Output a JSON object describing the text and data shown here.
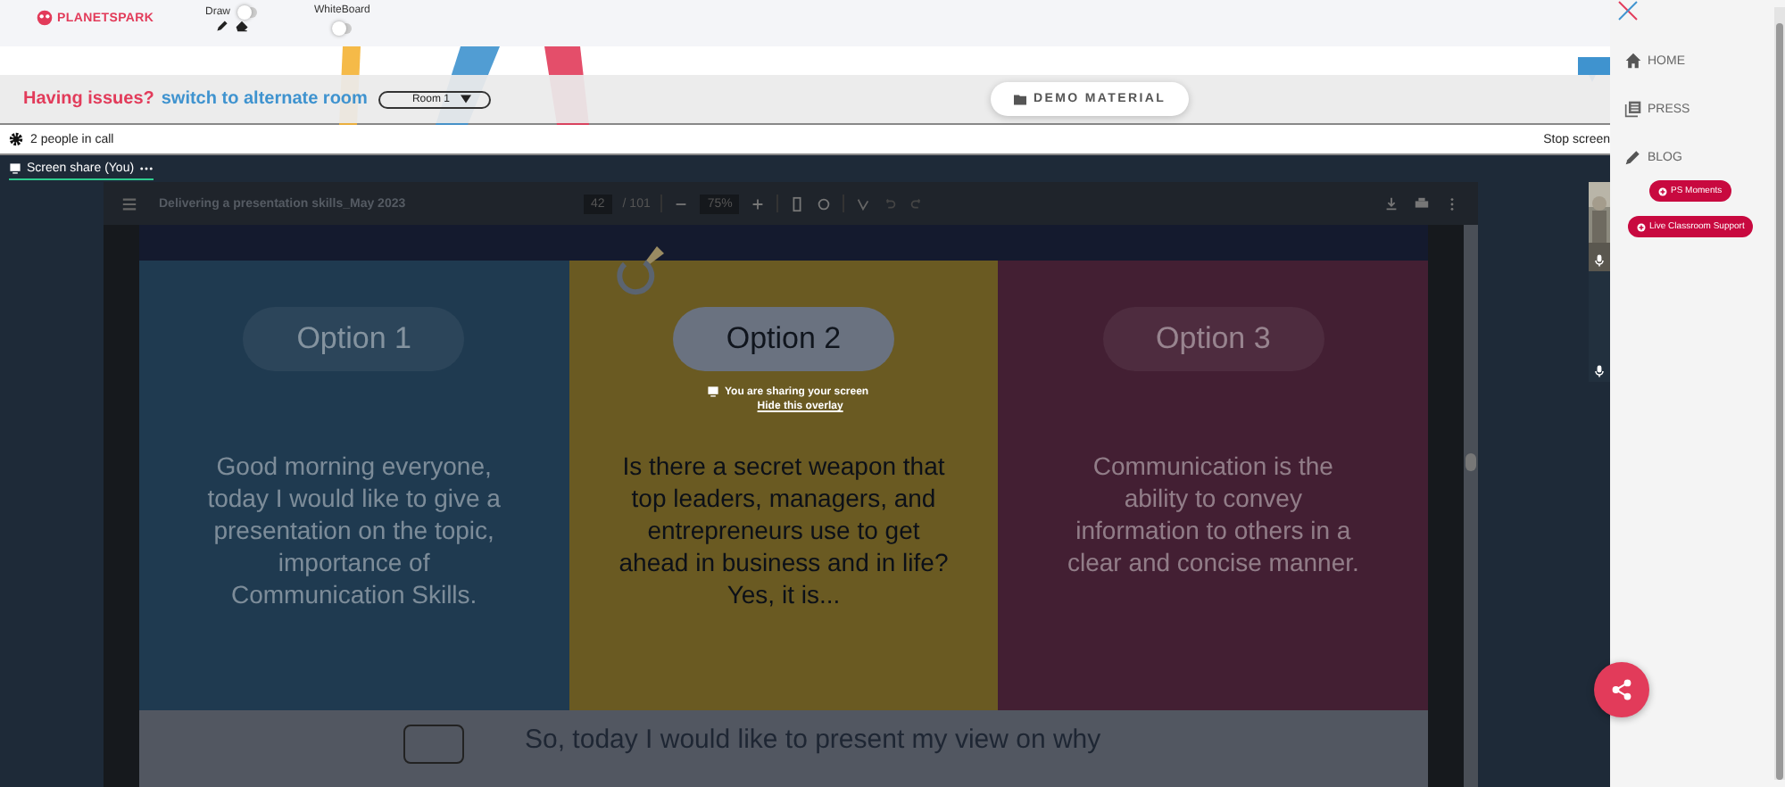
{
  "header": {
    "logo": "PLANETSPARK",
    "draw": {
      "label": "Draw",
      "on": false
    },
    "whiteboard": {
      "label": "WhiteBoard",
      "on": false
    }
  },
  "issues": {
    "question": "Having issues?",
    "link": "switch to alternate room",
    "room": "Room 1"
  },
  "demo_button": "DEMO MATERIAL",
  "call_bar": {
    "people": "2 people in call",
    "stop": "Stop screen"
  },
  "tab": {
    "label": "Screen share (You)",
    "selected": true
  },
  "pdf": {
    "title": "Delivering a presentation skills_May 2023",
    "page": "42",
    "total": "/ 101",
    "zoom": "75%"
  },
  "slide": {
    "options": [
      {
        "label": "Option 1",
        "body": [
          "Good morning everyone,",
          "today I would like to give a",
          "presentation on the topic,",
          "importance of",
          "Communication Skills."
        ],
        "color": "#1f3a50",
        "selected": false
      },
      {
        "label": "Option 2",
        "body": [
          "Is there a secret weapon that",
          "top leaders, managers, and",
          "entrepreneurs use to get",
          "ahead in business and in life?",
          "Yes, it is..."
        ],
        "color": "#6a5a22",
        "selected": true
      },
      {
        "label": "Option 3",
        "body": [
          "Communication is the",
          "ability to convey",
          "information to others in a",
          "clear and concise manner."
        ],
        "color": "#431f33",
        "selected": false
      }
    ],
    "footer": "So, today I would like to present my view on why"
  },
  "overlay": {
    "message": "You are sharing your screen",
    "hide": "Hide this overlay"
  },
  "sidebar": {
    "items": [
      {
        "label": "HOME"
      },
      {
        "label": "PRESS"
      },
      {
        "label": "BLOG"
      }
    ],
    "pills": [
      "PS Moments",
      "Live Classroom Support"
    ]
  }
}
